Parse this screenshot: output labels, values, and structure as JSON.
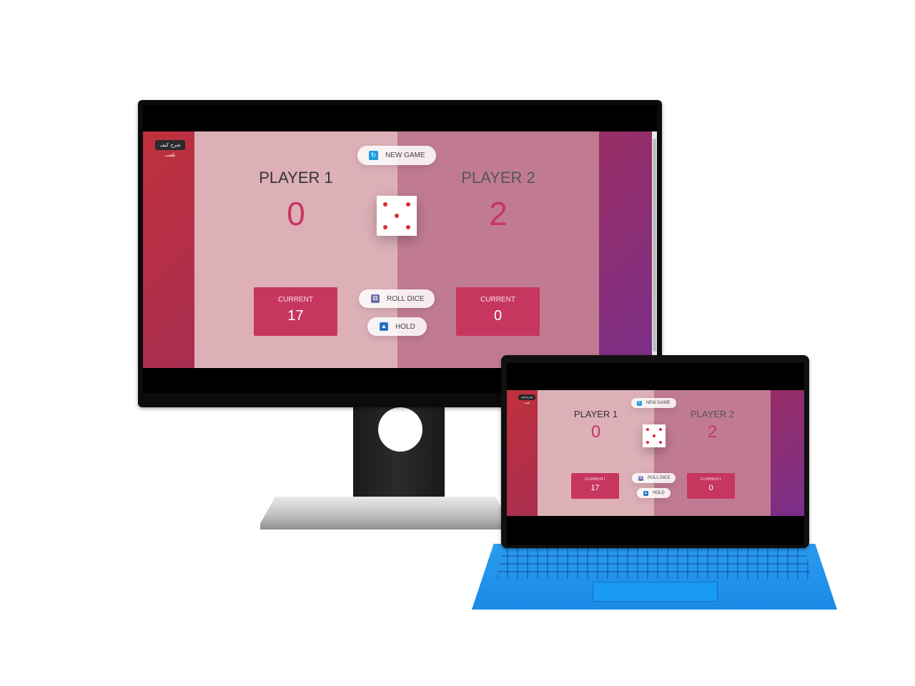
{
  "app": {
    "help_label": "شرح كيف تلعب",
    "new_game_label": "NEW GAME",
    "roll_dice_label": "ROLL DICE",
    "hold_label": "HOLD",
    "current_label": "CURRENT",
    "players": [
      {
        "name": "PLAYER 1",
        "score": "0",
        "current": "17"
      },
      {
        "name": "PLAYER 2",
        "score": "2",
        "current": "0"
      }
    ],
    "dice_value": 5,
    "icons": {
      "new_game": "refresh-icon",
      "roll_dice": "dice-icon",
      "hold": "hold-icon"
    }
  },
  "colors": {
    "accent": "#c7365f",
    "panel_active": "#ddb0b8",
    "panel_inactive": "#c07b93",
    "keyboard": "#1a8ae6"
  }
}
